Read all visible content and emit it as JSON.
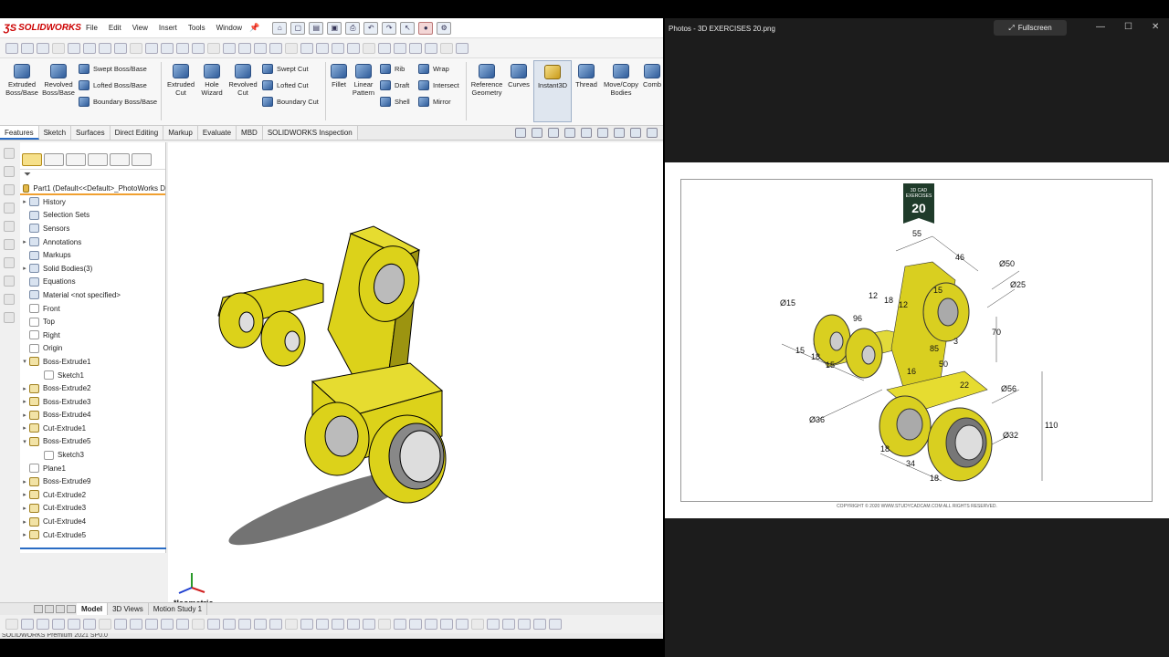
{
  "app": {
    "brand": "SOLIDWORKS",
    "menus": [
      "File",
      "Edit",
      "View",
      "Insert",
      "Tools",
      "Window"
    ]
  },
  "command_manager": {
    "extruded_boss": "Extruded Boss/Base",
    "revolved_boss": "Revolved Boss/Base",
    "swept_boss": "Swept Boss/Base",
    "lofted_boss": "Lofted Boss/Base",
    "boundary_boss": "Boundary Boss/Base",
    "extruded_cut": "Extruded Cut",
    "hole_wizard": "Hole Wizard",
    "revolved_cut": "Revolved Cut",
    "swept_cut": "Swept Cut",
    "lofted_cut": "Lofted Cut",
    "boundary_cut": "Boundary Cut",
    "fillet": "Fillet",
    "linear_pattern": "Linear Pattern",
    "rib": "Rib",
    "wrap": "Wrap",
    "draft": "Draft",
    "intersect": "Intersect",
    "shell": "Shell",
    "mirror": "Mirror",
    "reference_geometry": "Reference Geometry",
    "curves": "Curves",
    "instant3d": "Instant3D",
    "thread": "Thread",
    "move_copy": "Move/Copy Bodies",
    "combine": "Comb"
  },
  "tabs": [
    "Features",
    "Sketch",
    "Surfaces",
    "Direct Editing",
    "Markup",
    "Evaluate",
    "MBD",
    "SOLIDWORKS Inspection"
  ],
  "feature_tree": {
    "root": "Part1  (Default<<Default>_PhotoWorks D",
    "nodes": [
      {
        "label": "History",
        "icon": "folder",
        "arrow": "▸"
      },
      {
        "label": "Selection Sets",
        "icon": "folder",
        "arrow": ""
      },
      {
        "label": "Sensors",
        "icon": "folder",
        "arrow": ""
      },
      {
        "label": "Annotations",
        "icon": "folder",
        "arrow": "▸"
      },
      {
        "label": "Markups",
        "icon": "folder",
        "arrow": ""
      },
      {
        "label": "Solid Bodies(3)",
        "icon": "folder",
        "arrow": "▸"
      },
      {
        "label": "Equations",
        "icon": "folder",
        "arrow": ""
      },
      {
        "label": "Material <not specified>",
        "icon": "folder",
        "arrow": ""
      },
      {
        "label": "Front",
        "icon": "plane",
        "arrow": ""
      },
      {
        "label": "Top",
        "icon": "plane",
        "arrow": ""
      },
      {
        "label": "Right",
        "icon": "plane",
        "arrow": ""
      },
      {
        "label": "Origin",
        "icon": "origin",
        "arrow": ""
      },
      {
        "label": "Boss-Extrude1",
        "icon": "feature",
        "arrow": "▾"
      },
      {
        "label": "Sketch1",
        "icon": "sketch",
        "arrow": "",
        "indent": true
      },
      {
        "label": "Boss-Extrude2",
        "icon": "feature",
        "arrow": "▸"
      },
      {
        "label": "Boss-Extrude3",
        "icon": "feature",
        "arrow": "▸"
      },
      {
        "label": "Boss-Extrude4",
        "icon": "feature",
        "arrow": "▸"
      },
      {
        "label": "Cut-Extrude1",
        "icon": "feature",
        "arrow": "▸"
      },
      {
        "label": "Boss-Extrude5",
        "icon": "feature",
        "arrow": "▾"
      },
      {
        "label": "Sketch3",
        "icon": "sketch",
        "arrow": "",
        "indent": true
      },
      {
        "label": "Plane1",
        "icon": "plane",
        "arrow": ""
      },
      {
        "label": "Boss-Extrude9",
        "icon": "feature",
        "arrow": "▸"
      },
      {
        "label": "Cut-Extrude2",
        "icon": "feature",
        "arrow": "▸"
      },
      {
        "label": "Cut-Extrude3",
        "icon": "feature",
        "arrow": "▸"
      },
      {
        "label": "Cut-Extrude4",
        "icon": "feature",
        "arrow": "▸"
      },
      {
        "label": "Cut-Extrude5",
        "icon": "feature",
        "arrow": "▸"
      }
    ]
  },
  "viewport": {
    "view_label": "*Isometric"
  },
  "bottom_tabs": [
    "Model",
    "3D Views",
    "Motion Study 1"
  ],
  "status": "SOLIDWORKS Premium 2021 SP0.0",
  "photos": {
    "title": "Photos - 3D EXERCISES 20.png",
    "fullscreen": "Fullscreen",
    "badge_line1": "3D CAD",
    "badge_line2": "EXERCISES",
    "badge_num": "20",
    "copyright": "COPYRIGHT © 2020 WWW.STUDYCADCAM.COM ALL RIGHTS RESERVED.",
    "dims": [
      "55",
      "46",
      "Ø50",
      "Ø25",
      "Ø15",
      "70",
      "15",
      "18",
      "15",
      "50",
      "Ø36",
      "Ø56",
      "110",
      "Ø32",
      "18",
      "34",
      "18",
      "12",
      "18",
      "12",
      "15",
      "3",
      "22",
      "85",
      "16",
      "96"
    ]
  },
  "colors": {
    "part_yellow": "#dcd21a",
    "part_shadow": "#9c9410",
    "accent": "#2a6cc4",
    "badge": "#1f3b2a"
  }
}
